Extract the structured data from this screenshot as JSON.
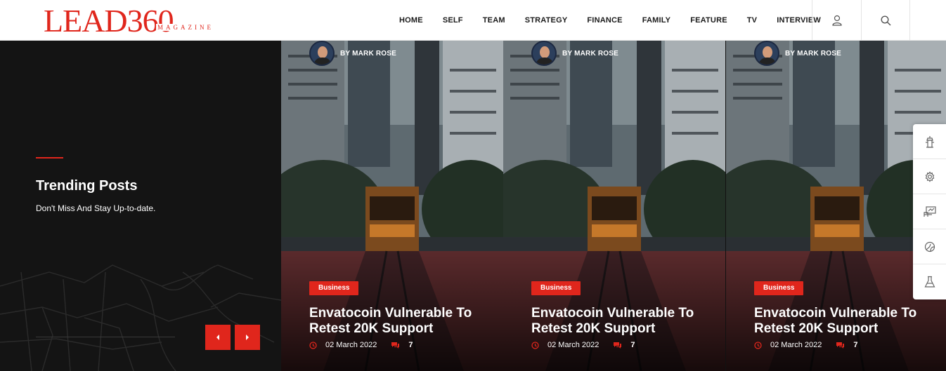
{
  "logo": {
    "main": "LEAD360",
    "sub": "MAGAZINE"
  },
  "nav": [
    "HOME",
    "SELF",
    "TEAM",
    "STRATEGY",
    "FINANCE",
    "FAMILY",
    "FEATURE",
    "TV",
    "INTERVIEW"
  ],
  "header_icons": [
    "user-icon",
    "search-icon"
  ],
  "trending": {
    "title": "Trending Posts",
    "subtitle": "Don't Miss And Stay Up-to-date."
  },
  "slider_controls": [
    "chevron-left-icon",
    "chevron-right-icon"
  ],
  "cards": [
    {
      "author": "BY MARK ROSE",
      "category": "Business",
      "title": "Envatocoin Vulnerable To Retest 20K Support",
      "date": "02 March 2022",
      "comments": "7"
    },
    {
      "author": "BY MARK ROSE",
      "category": "Business",
      "title": "Envatocoin Vulnerable To Retest 20K Support",
      "date": "02 March 2022",
      "comments": "7"
    },
    {
      "author": "BY MARK ROSE",
      "category": "Business",
      "title": "Envatocoin Vulnerable To Retest 20K Support",
      "date": "02 March 2022",
      "comments": "7"
    }
  ],
  "side_tools": [
    "fire-hydrant-icon",
    "gear-icon",
    "dashboard-icon",
    "palette-icon",
    "flask-icon"
  ],
  "colors": {
    "accent": "#e0261c",
    "dark_panel": "#141414",
    "header_bg": "#ffffff"
  }
}
